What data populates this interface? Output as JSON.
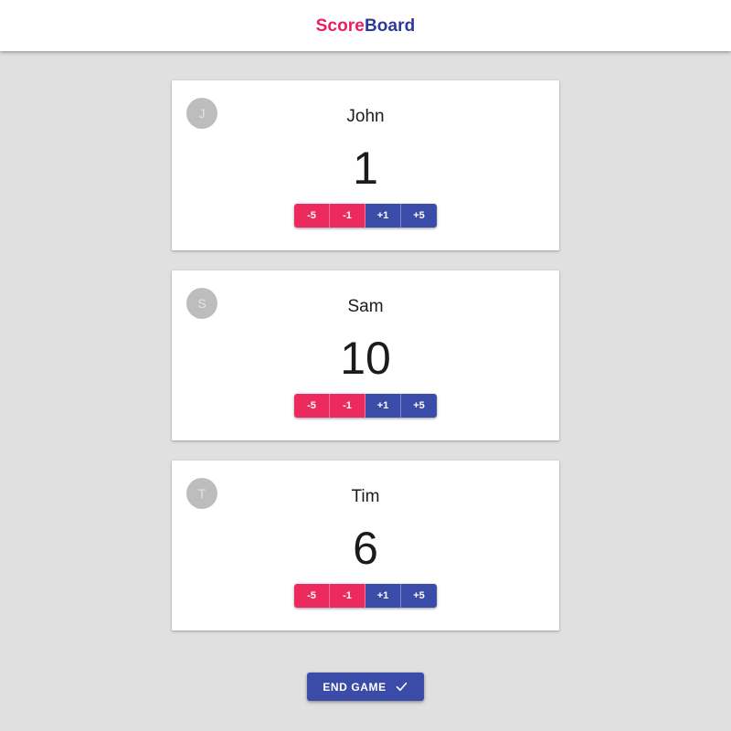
{
  "header": {
    "title_part_a": "Score",
    "title_part_b": "Board",
    "accent_pink": "#e91e63",
    "accent_blue": "#2d3a9c"
  },
  "theme": {
    "background": "#e0e0e0",
    "card_background": "#ffffff",
    "negative_button": "#ec2a5e",
    "positive_button": "#3b4ba8",
    "avatar_background": "#bdbdbd"
  },
  "score_buttons": [
    {
      "label": "-5",
      "kind": "negative"
    },
    {
      "label": "-1",
      "kind": "negative"
    },
    {
      "label": "+1",
      "kind": "positive"
    },
    {
      "label": "+5",
      "kind": "positive"
    }
  ],
  "players": [
    {
      "avatar_initial": "J",
      "name": "John",
      "score": "1"
    },
    {
      "avatar_initial": "S",
      "name": "Sam",
      "score": "10"
    },
    {
      "avatar_initial": "T",
      "name": "Tim",
      "score": "6"
    }
  ],
  "footer": {
    "end_game_label": "END GAME",
    "end_game_icon": "check-icon"
  }
}
